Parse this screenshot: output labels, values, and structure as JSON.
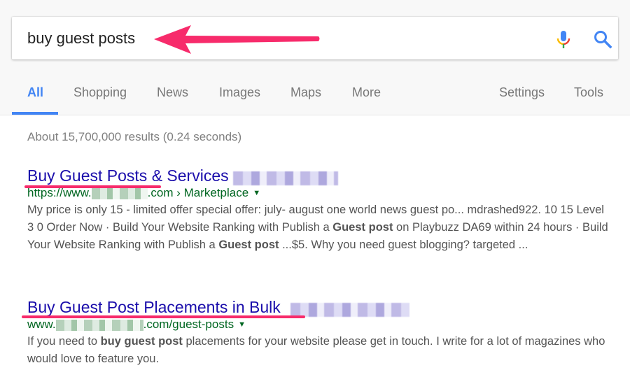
{
  "search": {
    "query": "buy guest posts",
    "mic_icon": "microphone-icon",
    "search_icon": "magnifier-icon"
  },
  "annotation": {
    "arrow_color": "#f72b6b",
    "underline_color": "#f72b6b"
  },
  "tabs": [
    {
      "label": "All",
      "active": true
    },
    {
      "label": "Shopping",
      "active": false
    },
    {
      "label": "News",
      "active": false
    },
    {
      "label": "Images",
      "active": false
    },
    {
      "label": "Maps",
      "active": false
    },
    {
      "label": "More",
      "active": false
    }
  ],
  "tools": {
    "settings_label": "Settings",
    "tools_label": "Tools"
  },
  "result_stats": "About 15,700,000 results (0.24 seconds)",
  "results": [
    {
      "title": "Buy Guest Posts & Services",
      "url_prefix": "https://www.",
      "url_suffix": ".com › Marketplace",
      "snippet_parts": [
        {
          "text": "My price is only 15 - limited offer special offer: july- august one world news guest po... mdrashed922. 10 15 Level 3 0 Order Now · Build Your Website Ranking with Publish a ",
          "bold": false
        },
        {
          "text": "Guest post",
          "bold": true
        },
        {
          "text": " on Playbuzz DA69 within 24 hours · Build Your Website Ranking with Publish a ",
          "bold": false
        },
        {
          "text": "Guest post",
          "bold": true
        },
        {
          "text": " ...$5. Why you need guest blogging? targeted ...",
          "bold": false
        }
      ]
    },
    {
      "title": "Buy Guest Post Placements in Bulk",
      "url_prefix": "www.",
      "url_suffix": ".com/guest-posts",
      "snippet_parts": [
        {
          "text": "If you need to ",
          "bold": false
        },
        {
          "text": "buy guest post",
          "bold": true
        },
        {
          "text": " placements for your website please get in touch. I write for a lot of magazines who would love to feature you.",
          "bold": false
        }
      ]
    }
  ],
  "colors": {
    "accent_blue": "#4285f4",
    "link_title": "#1a0dab",
    "url_green": "#006621",
    "snippet_gray": "#545454"
  }
}
